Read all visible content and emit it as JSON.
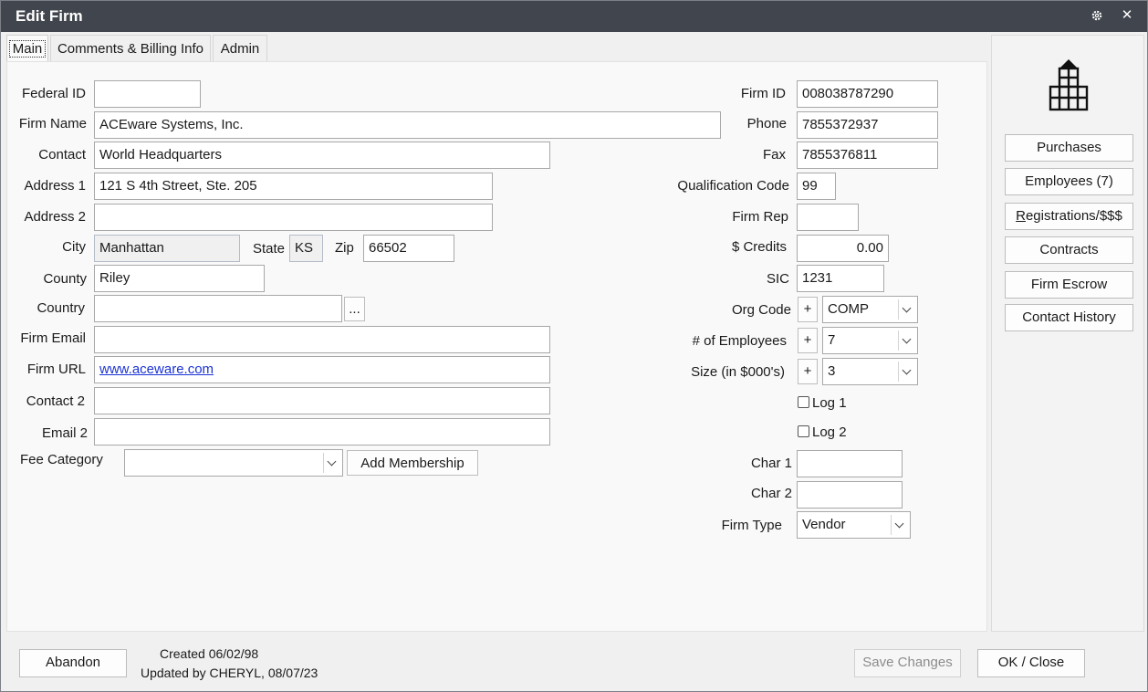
{
  "window": {
    "title": "Edit Firm",
    "settings_icon": "gear-icon",
    "close_label": "✕"
  },
  "tabs": [
    {
      "label": "Main",
      "active": true
    },
    {
      "label": "Comments & Billing Info",
      "active": false
    },
    {
      "label": "Admin",
      "active": false
    }
  ],
  "form_left": {
    "federal_id": {
      "label": "Federal ID",
      "value": ""
    },
    "firm_name": {
      "label": "Firm Name",
      "value": "ACEware Systems, Inc."
    },
    "contact": {
      "label": "Contact",
      "value": "World Headquarters"
    },
    "address1": {
      "label": "Address 1",
      "value": "121 S 4th Street, Ste. 205"
    },
    "address2": {
      "label": "Address 2",
      "value": ""
    },
    "city": {
      "label": "City",
      "value": "Manhattan"
    },
    "state": {
      "label": "State",
      "value": "KS"
    },
    "zip": {
      "label": "Zip",
      "value": "66502"
    },
    "county": {
      "label": "County",
      "value": "Riley"
    },
    "country": {
      "label": "Country",
      "value": "",
      "browse_label": "..."
    },
    "firm_email": {
      "label": "Firm Email",
      "value": ""
    },
    "firm_url": {
      "label": "Firm URL",
      "value": "www.aceware.com"
    },
    "contact2": {
      "label": "Contact 2",
      "value": ""
    },
    "email2": {
      "label": "Email 2",
      "value": ""
    },
    "fee_category": {
      "label": "Fee Category",
      "value": "",
      "add_button": "Add Membership"
    }
  },
  "form_right": {
    "firm_id": {
      "label": "Firm ID",
      "value": "008038787290"
    },
    "phone": {
      "label": "Phone",
      "value": "7855372937"
    },
    "fax": {
      "label": "Fax",
      "value": "7855376811"
    },
    "qualification_code": {
      "label": "Qualification Code",
      "value": "99"
    },
    "firm_rep": {
      "label": "Firm Rep",
      "value": ""
    },
    "credits": {
      "label": "$ Credits",
      "value": "0.00"
    },
    "sic": {
      "label": "SIC",
      "value": "1231"
    },
    "org_code": {
      "label": "Org Code",
      "value": "COMP",
      "plus": "+"
    },
    "num_employees": {
      "label": "# of Employees",
      "value": "7",
      "plus": "+"
    },
    "size": {
      "label": "Size (in $000's)",
      "value": "3",
      "plus": "+"
    },
    "log1": {
      "label": "Log 1",
      "checked": false
    },
    "log2": {
      "label": "Log 2",
      "checked": false
    },
    "char1": {
      "label": "Char 1",
      "value": ""
    },
    "char2": {
      "label": "Char 2",
      "value": ""
    },
    "firm_type": {
      "label": "Firm Type",
      "value": "Vendor"
    }
  },
  "sidebar": {
    "logo_icon": "building-icon",
    "buttons": [
      "Purchases",
      "Employees (7)",
      "Registrations/$$$",
      "Contracts",
      "Firm Escrow",
      "Contact History"
    ]
  },
  "footer": {
    "abandon": "Abandon",
    "created": "Created 06/02/98",
    "updated": "Updated by CHERYL, 08/07/23",
    "save_changes": "Save Changes",
    "ok_close": "OK / Close"
  }
}
